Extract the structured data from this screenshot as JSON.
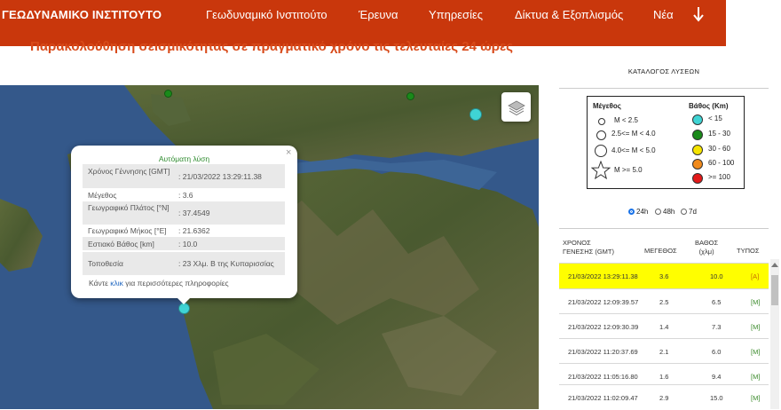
{
  "navbar": {
    "brand": "ΓΕΩΔΥΝΑΜΙΚΟ ΙΝΣΤΙΤΟΥΤΟ",
    "items": [
      "Γεωδυναμικό Ινστιτούτο",
      "Έρευνα",
      "Υπηρεσίες",
      "Δίκτυα & Εξοπλισμός",
      "Νέα"
    ],
    "icon": "arrow-down-icon",
    "color": "#c9370c"
  },
  "subtitle": "Παρακολούθηση σεισμικότητας σε πραγματικό χρόνο τις τελευταίες 24 ώρες",
  "map": {
    "layers_icon": "layers-icon",
    "popup": {
      "heading": "Αυτόματη λύση",
      "close": "×",
      "rows": [
        {
          "key": "Χρόνος Γέννησης [GMT]",
          "value": ": 21/03/2022 13:29:11.38"
        },
        {
          "key": "Μέγεθος",
          "value": ": 3.6"
        },
        {
          "key": "Γεωγραφικό Πλάτος [°N]",
          "value": ": 37.4549"
        },
        {
          "key": "Γεωγραφικό Μήκος [°E]",
          "value": ": 21.6362"
        },
        {
          "key": "Εστιακό Βάθος [km]",
          "value": ": 10.0"
        },
        {
          "key": "Τοποθεσία",
          "value": ": 23 Χλμ. Β της Κυπαρισσίας"
        }
      ],
      "footer_pre": "Κάντε ",
      "footer_link": "κλικ",
      "footer_post": " για περισσότερες πληροφορίες"
    }
  },
  "catalog": {
    "title": "ΚΑΤΑΛΟΓΟΣ ΛΥΣΕΩΝ",
    "legend": {
      "magnitude_head": "Μέγεθος",
      "depth_head": "Βάθος (Km)",
      "magnitudes": [
        "M < 2.5",
        "2.5<= M < 4.0",
        "4.0<= M < 5.0",
        "M >= 5.0"
      ],
      "depths": [
        {
          "label": "< 15",
          "color": "#3fd4d4"
        },
        {
          "label": "15 - 30",
          "color": "#1a8a1a"
        },
        {
          "label": "30 - 60",
          "color": "#f5e400"
        },
        {
          "label": "60 - 100",
          "color": "#f08a1c"
        },
        {
          "label": ">= 100",
          "color": "#e31a1a"
        }
      ]
    },
    "periods": [
      {
        "label": "24h",
        "selected": true
      },
      {
        "label": "48h",
        "selected": false
      },
      {
        "label": "7d",
        "selected": false
      }
    ],
    "columns": {
      "time": [
        "ΧΡΟΝΟΣ",
        "ΓΕΝΕΣΗΣ (GMT)"
      ],
      "mag": [
        "ΜΕΓΕΘΟΣ"
      ],
      "depth": [
        "ΒΑΘΟΣ",
        "(χλμ)"
      ],
      "type": [
        "ΤΥΠΟΣ"
      ]
    },
    "rows": [
      {
        "time": "21/03/2022 13:29:11.38",
        "mag": "3.6",
        "depth": "10.0",
        "type": "[A]"
      },
      {
        "time": "21/03/2022 12:09:39.57",
        "mag": "2.5",
        "depth": "6.5",
        "type": "[M]"
      },
      {
        "time": "21/03/2022 12:09:30.39",
        "mag": "1.4",
        "depth": "7.3",
        "type": "[M]"
      },
      {
        "time": "21/03/2022 11:20:37.69",
        "mag": "2.1",
        "depth": "6.0",
        "type": "[M]"
      },
      {
        "time": "21/03/2022 11:05:16.80",
        "mag": "1.6",
        "depth": "9.4",
        "type": "[M]"
      },
      {
        "time": "21/03/2022 11:02:09.47",
        "mag": "2.9",
        "depth": "15.0",
        "type": "[M]"
      }
    ],
    "highlight_color": "#fffe00"
  }
}
